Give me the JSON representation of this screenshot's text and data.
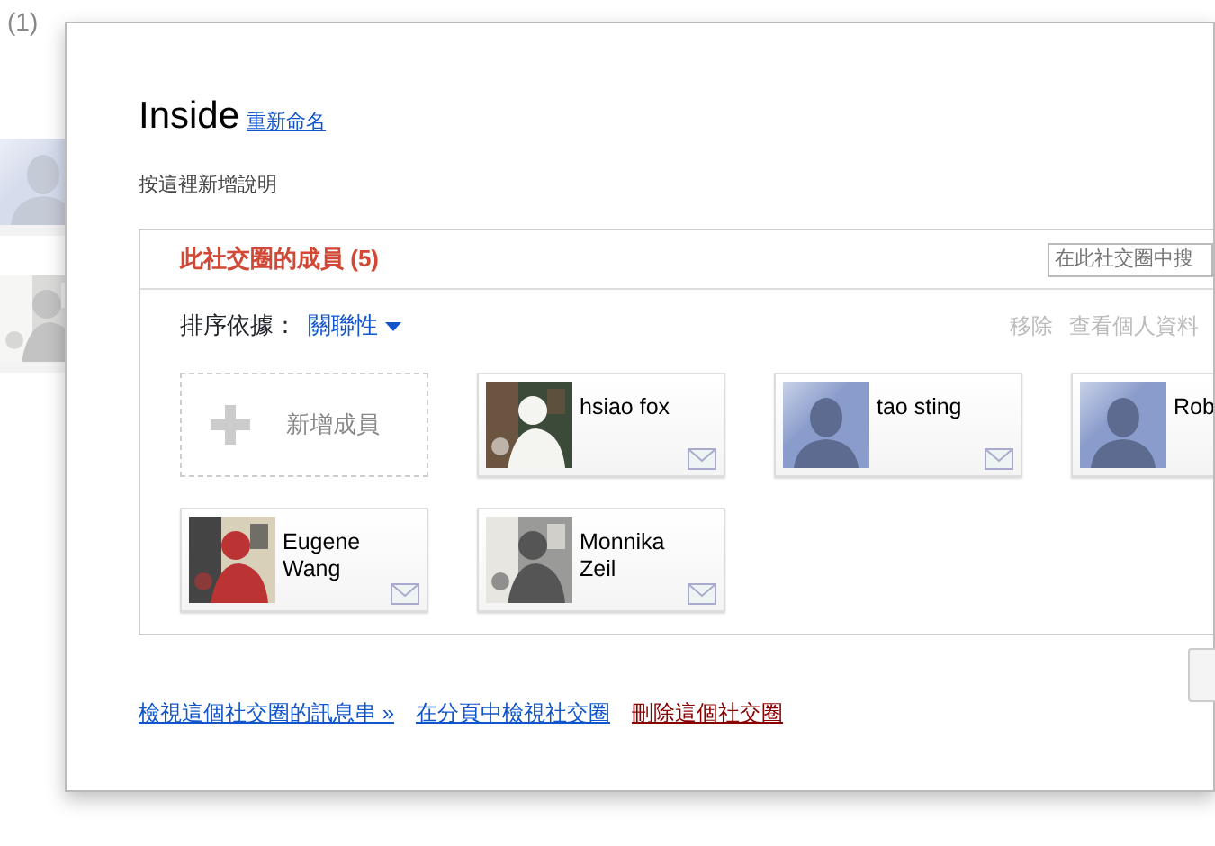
{
  "background": {
    "tabs": [
      "(1)"
    ]
  },
  "dialog": {
    "title": "Inside",
    "rename_link": "重新命名",
    "description": "按這裡新增說明",
    "members_tab": "此社交圈的成員 (5)",
    "search": {
      "placeholder": "在此社交圈中搜"
    },
    "sort_label": "排序依據：",
    "sort_value": "關聯性",
    "actions": [
      {
        "label": "移除",
        "disabled": true
      },
      {
        "label": "查看個人資料",
        "disabled": true
      }
    ],
    "add_member": "新增成員",
    "members": [
      {
        "name": "hsiao fox",
        "kind": "picture",
        "mail": true
      },
      {
        "name": "tao sting",
        "kind": "avatar",
        "mail": true
      },
      {
        "name": "Rob",
        "kind": "avatar",
        "mail": false
      },
      {
        "name": "Eugene Wang",
        "kind": "picture",
        "mail": true
      },
      {
        "name": "Monnika Zeil",
        "kind": "picture",
        "mail": true
      }
    ],
    "footer_links": [
      {
        "label": "檢視這個社交圈的訊息串 »",
        "kind": "normal"
      },
      {
        "label": "在分頁中檢視社交圈",
        "kind": "normal"
      },
      {
        "label": "刪除這個社交圈",
        "kind": "danger"
      }
    ]
  }
}
